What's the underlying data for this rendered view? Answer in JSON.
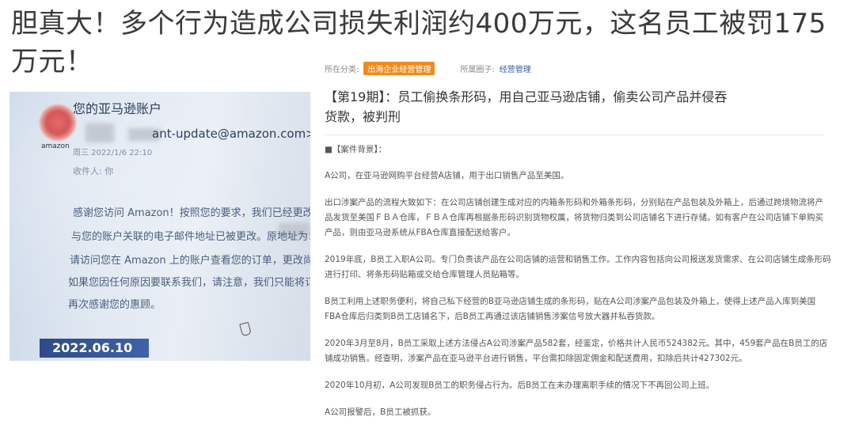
{
  "headline": "胆真大！多个行为造成公司损失利润约400万元，这名员工被罚175万元！",
  "photo": {
    "title": "您的亚马逊账户",
    "email": "ant-update@amazon.com>",
    "logo_text": "amazon",
    "date_line": "周三 2022/1/6 22:10",
    "to_line": "收件人: 你",
    "body_lines": [
      "感谢您访问 Amazon！按照您的要求，我们已经更改了与您的",
      "与您的账户关联的电子邮件地址已被更改。原地址为：",
      "请访问您在 Amazon 上的账户查看您的订单，更改尚未进入发",
      "如果您因任何原因要联系我们，请注意，我们只能将订单信息",
      "再次感谢您的惠顾。"
    ],
    "date_badge": "2022.06.10"
  },
  "meta": {
    "category_label": "所在分类:",
    "category_tag": "出海企业经营管理",
    "circle_label": "所属圈子:",
    "circle_tag": "经营管理"
  },
  "case_title": "【第19期】：员工偷换条形码，用自己亚马逊店铺，偷卖公司产品并侵吞货款，被判刑",
  "article": {
    "bg_head": "■【案件背景】：",
    "paragraphs": [
      "A公司，在亚马逊网购平台经营A店铺，用于出口销售产品至美国。",
      "出口涉案产品的流程大致如下：在公司店铺创建生成对应的内箱条形码和外箱条形码，分别贴在产品包装及外箱上，后通过跨境物流将产品发货至美国ＦＢＡ仓库，ＦＢＡ仓库再根据条形码识别货物权属，将货物归类到公司店铺名下进行存储。如有客户在公司店铺下单购买产品，则由亚马逊系统从FBA仓库直接配送给客户。",
      "2019年底，B员工入职A公司。专门负责该产品在公司店铺的运营和销售工作。工作内容包括向公司报送发货需求、在公司店铺生成条形码进行打印、将条形码贴箱或交给仓库管理人员贴箱等。",
      "B员工利用上述职务便利，将自己私下经营的B亚马逊店铺生成的条形码，贴在A公司涉案产品包装及外箱上，使得上述产品入库到美国FBA仓库后归类到B员工店铺名下，后B员工再通过该店铺销售涉案信号放大器并私吞货款。",
      "2020年3月至8月，B员工采取上述方法侵占A公司涉案产品582套，经鉴定，价格共计人民币524382元。其中，459套产品在B员工的店铺成功销售。经查明，涉案产品在亚马逊平台进行销售，平台需扣除固定佣金和配送费用，扣除后共计427302元。",
      "2020年10月初，A公司发现B员工的职务侵占行为。后B员工在未办理离职手续的情况下不再回公司上班。",
      "A公司报警后，B员工被抓获。"
    ]
  }
}
